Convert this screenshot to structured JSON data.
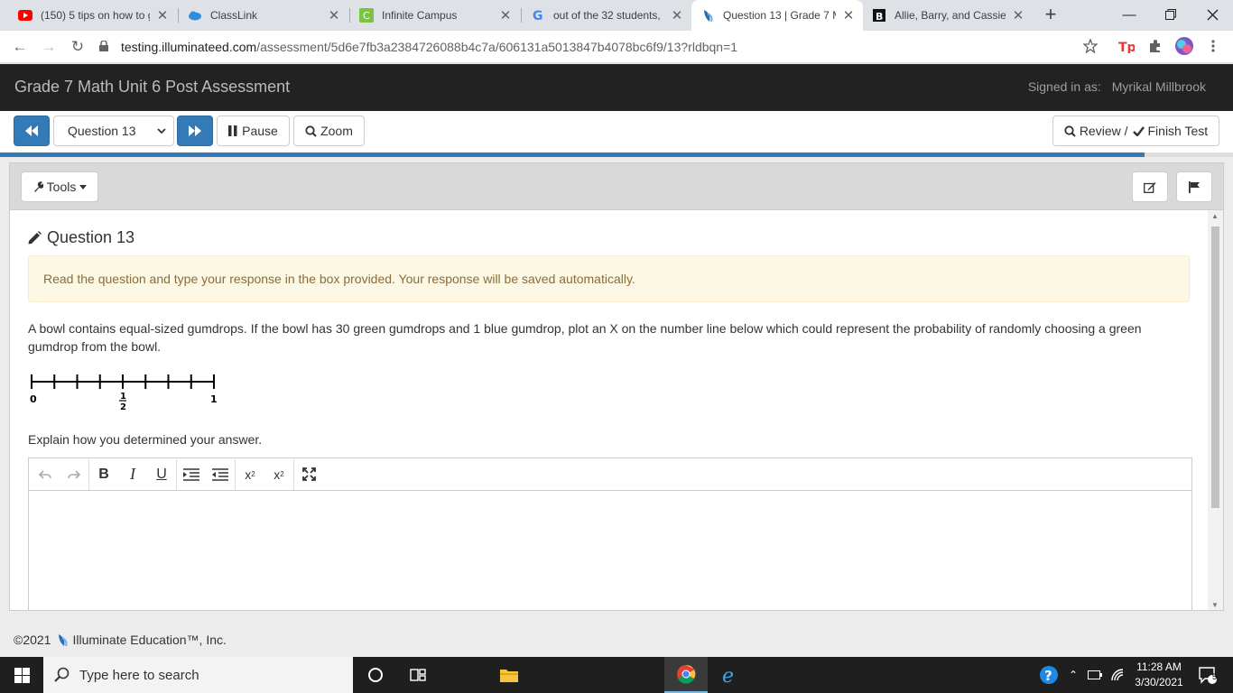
{
  "browser": {
    "tabs": [
      {
        "title": "(150) 5 tips on how to g",
        "icon": "youtube-icon"
      },
      {
        "title": "ClassLink",
        "icon": "classlink-icon"
      },
      {
        "title": "Infinite Campus",
        "icon": "infinite-campus-icon"
      },
      {
        "title": "out of the 32 students, ",
        "icon": "google-icon"
      },
      {
        "title": "Question 13 | Grade 7 M",
        "icon": "illuminate-icon",
        "active": true
      },
      {
        "title": "Allie, Barry, and Cassie",
        "icon": "brainly-icon"
      }
    ],
    "address": {
      "host": "testing.illuminateed.com",
      "path": "/assessment/5d6e7fb3a2384726088b4c7a/606131a5013847b4078bc6f9/13?rldbqn=1"
    }
  },
  "app": {
    "title": "Grade 7 Math Unit 6 Post Assessment",
    "signed_label": "Signed in as:",
    "user": "Myrikal Millbrook"
  },
  "nav": {
    "question_select": "Question 13",
    "pause_label": "Pause",
    "zoom_label": "Zoom",
    "review_label": "Review /",
    "finish_label": "Finish Test",
    "progress_fraction": 0.928
  },
  "panel": {
    "tools_label": "Tools"
  },
  "question": {
    "title": "Question 13",
    "instructions": "Read the question and type your response in the box provided. Your response will be saved automatically.",
    "prompt": "A bowl contains equal-sized gumdrops. If the bowl has 30 green gumdrops and 1 blue gumdrop, plot an X on the number line below which could represent the probability of randomly choosing a green gumdrop from the bowl.",
    "numberline": {
      "label_start": "0",
      "label_mid_num": "1",
      "label_mid_den": "2",
      "label_end": "1",
      "tick_count": 9
    },
    "explain": "Explain how you determined your answer.",
    "editor_tools": [
      "undo-icon",
      "redo-icon",
      "bold-icon",
      "italic-icon",
      "underline-icon",
      "indent-icon",
      "outdent-icon",
      "subscript-icon",
      "superscript-icon",
      "fullscreen-icon"
    ]
  },
  "footer": {
    "copyright": "©2021",
    "company": "Illuminate Education™, Inc."
  },
  "taskbar": {
    "search_placeholder": "Type here to search",
    "time": "11:28 AM",
    "date": "3/30/2021",
    "notification_count": "5"
  }
}
